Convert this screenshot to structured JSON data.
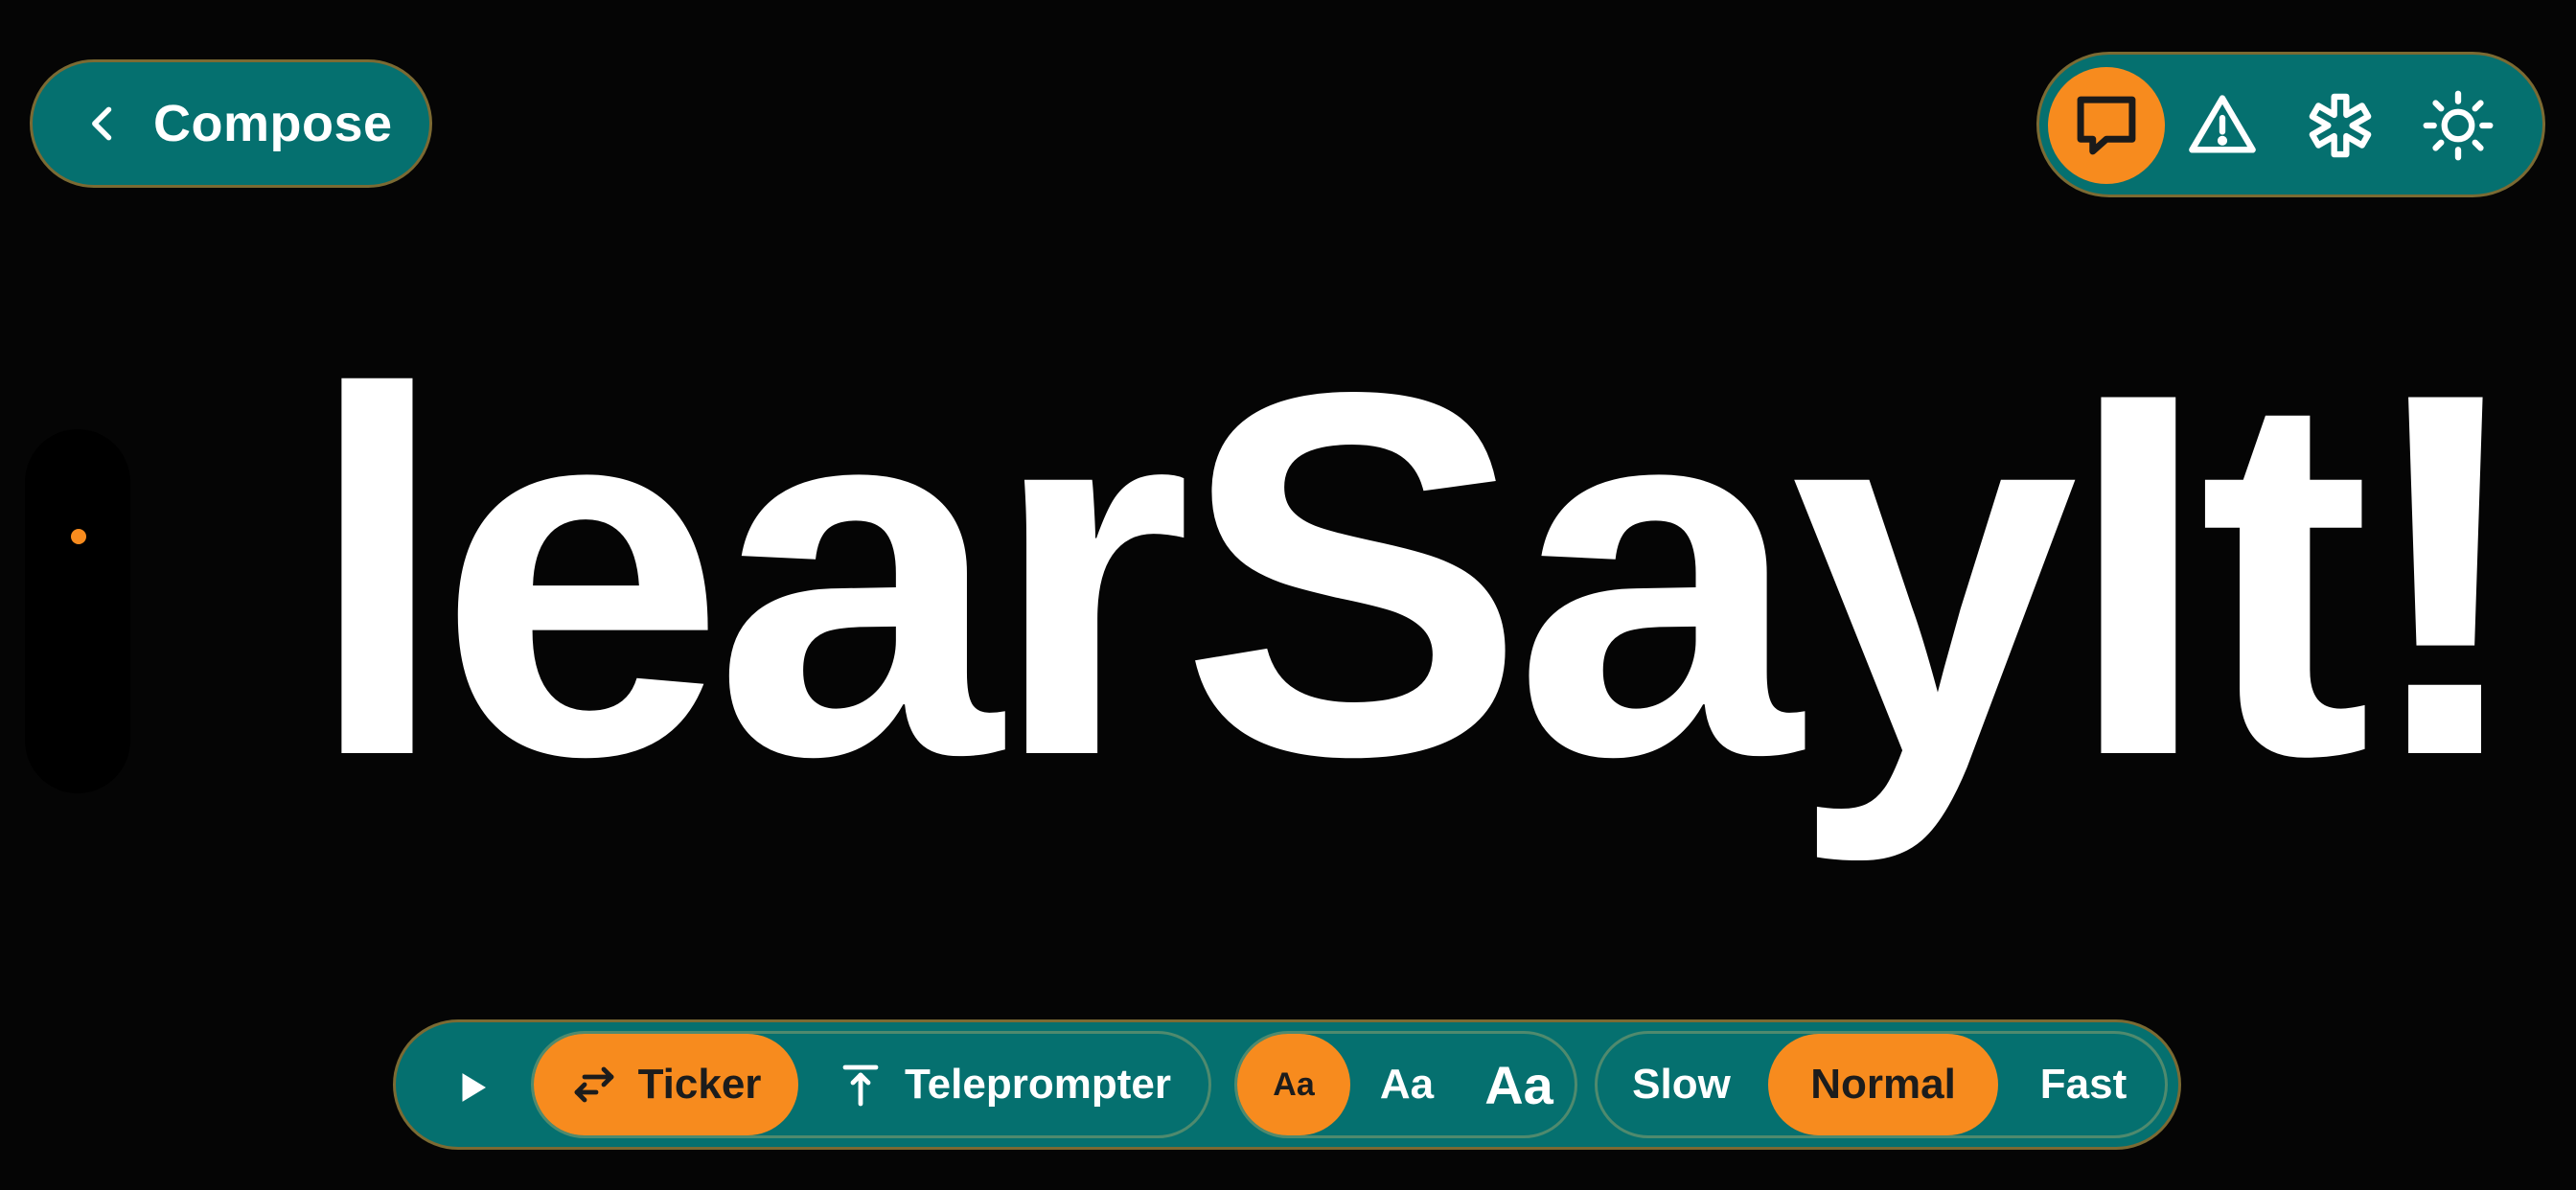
{
  "header": {
    "back_label": "Compose"
  },
  "modes": [
    {
      "name": "message",
      "icon": "speech-bubble-icon",
      "active": true
    },
    {
      "name": "warning",
      "icon": "warning-triangle-icon",
      "active": false
    },
    {
      "name": "medical",
      "icon": "asterisk-icon",
      "active": false
    },
    {
      "name": "brightness",
      "icon": "sun-icon",
      "active": false
    }
  ],
  "display": {
    "text": "learSayIt!"
  },
  "toolbar": {
    "play_icon": "play-icon",
    "layout": {
      "ticker_label": "Ticker",
      "teleprompter_label": "Teleprompter",
      "selected": "Ticker"
    },
    "size": {
      "options": [
        "Aa",
        "Aa",
        "Aa"
      ],
      "selected_index": 0
    },
    "speed": {
      "options": [
        "Slow",
        "Normal",
        "Fast"
      ],
      "selected": "Normal"
    }
  },
  "colors": {
    "background": "#050505",
    "teal": "#05706f",
    "accent": "#f78b1e",
    "text": "#ffffff",
    "border": "#7b6a33"
  }
}
